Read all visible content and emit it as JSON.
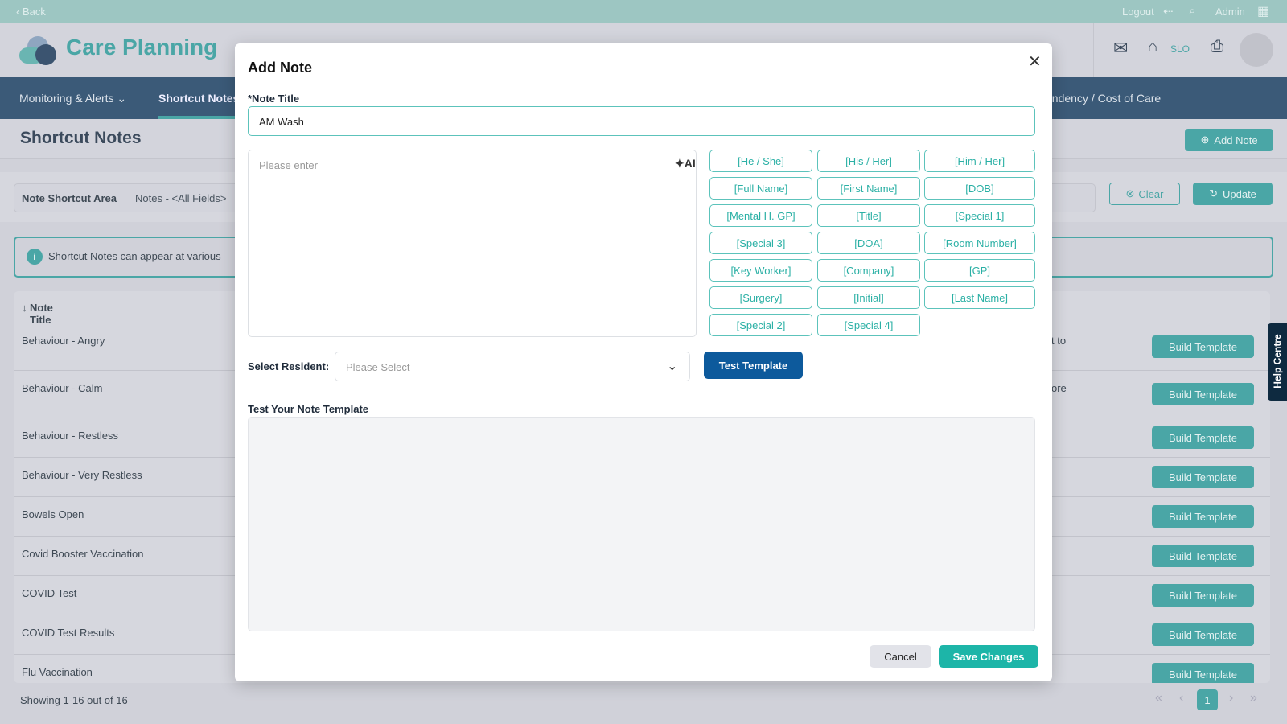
{
  "topbar": {
    "back": "‹ Back",
    "logout": "Logout",
    "admin": "Admin"
  },
  "header": {
    "app_name": "Care Planning",
    "home_label": "SLO"
  },
  "nav": {
    "items": [
      "Monitoring & Alerts",
      "Shortcut Notes",
      "endency / Cost of Care"
    ]
  },
  "page": {
    "title": "Shortcut Notes",
    "add_note": "Add Note"
  },
  "filter": {
    "area_label": "Note Shortcut Area",
    "area_value": "Notes - <All Fields>",
    "clear": "Clear",
    "update": "Update"
  },
  "info": {
    "text": "Shortcut Notes can appear at various"
  },
  "table": {
    "header": "Note Title",
    "rows": [
      {
        "title": "Behaviour - Angry",
        "extra": "t to"
      },
      {
        "title": "Behaviour - Calm",
        "extra": "ore"
      },
      {
        "title": "Behaviour - Restless",
        "extra": ""
      },
      {
        "title": "Behaviour - Very Restless",
        "extra": ""
      },
      {
        "title": "Bowels Open",
        "extra": ""
      },
      {
        "title": "Covid Booster Vaccination",
        "extra": ""
      },
      {
        "title": "COVID Test",
        "extra": ""
      },
      {
        "title": "COVID Test Results",
        "extra": ""
      },
      {
        "title": "Flu Vaccination",
        "extra": ""
      }
    ],
    "build_label": "Build Template"
  },
  "footer": {
    "showing": "Showing 1-16 out of 16",
    "page": "1"
  },
  "help": {
    "label": "Help Centre"
  },
  "modal": {
    "title": "Add Note",
    "note_title_label": "*Note Title",
    "note_title_value": "AM Wash",
    "body_placeholder": "Please enter",
    "ai_label": "AI",
    "tags": [
      "[He / She]",
      "[His / Her]",
      "[Him / Her]",
      "[Full Name]",
      "[First Name]",
      "[DOB]",
      "[Mental H. GP]",
      "[Title]",
      "[Special 1]",
      "[Special 3]",
      "[DOA]",
      "[Room Number]",
      "[Key Worker]",
      "[Company]",
      "[GP]",
      "[Surgery]",
      "[Initial]",
      "[Last Name]",
      "[Special 2]",
      "[Special 4]"
    ],
    "select_resident_label": "Select Resident:",
    "select_placeholder": "Please Select",
    "test_template": "Test Template",
    "test_label": "Test Your Note Template",
    "cancel": "Cancel",
    "save": "Save Changes"
  },
  "colors": {
    "teal": "#1db5a8",
    "navy": "#0d5a9c",
    "nav": "#3b5a78"
  }
}
